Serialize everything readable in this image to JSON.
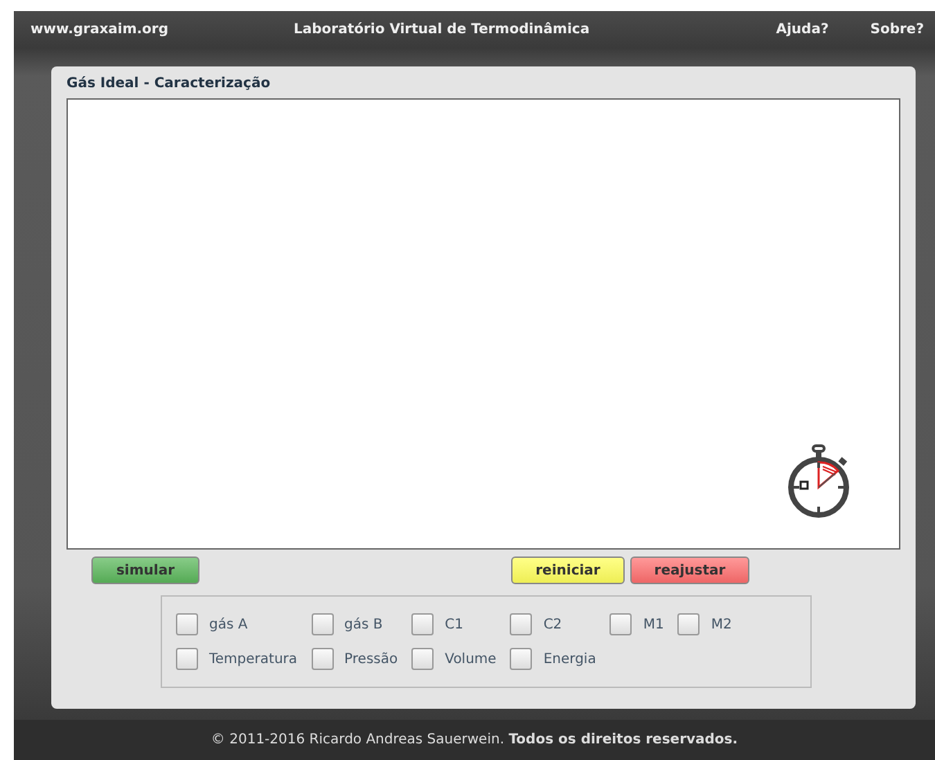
{
  "header": {
    "site": "www.graxaim.org",
    "title": "Laboratório Virtual de Termodinâmica",
    "links": [
      "Ajuda?",
      "Sobre?"
    ]
  },
  "panel": {
    "title": "Gás Ideal - Caracterização"
  },
  "buttons": [
    {
      "label": "simular",
      "kind": "go"
    },
    {
      "label": "reiniciar",
      "kind": "restart"
    },
    {
      "label": "reajustar",
      "kind": "reset"
    }
  ],
  "options": [
    {
      "label": "gás A",
      "checked": false
    },
    {
      "label": "gás B",
      "checked": false
    },
    {
      "label": "C1",
      "checked": false
    },
    {
      "label": "C2",
      "checked": false
    },
    {
      "label": "M1",
      "checked": false
    },
    {
      "label": "M2",
      "checked": false
    },
    {
      "label": "Temperatura",
      "checked": false
    },
    {
      "label": "Pressão",
      "checked": false
    },
    {
      "label": "Volume",
      "checked": false
    },
    {
      "label": "Energia",
      "checked": false
    }
  ],
  "footer": "© 2011-2016 Ricardo Andreas Sauerwein. **Todos os direitos reservados.**"
}
